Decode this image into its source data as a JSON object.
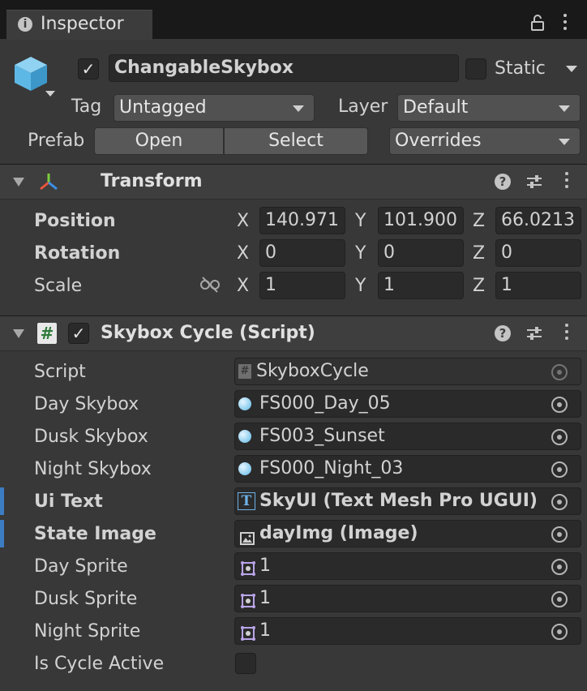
{
  "tab": {
    "title": "Inspector"
  },
  "gameobject": {
    "active": true,
    "name": "ChangableSkybox",
    "static_label": "Static",
    "static_checked": false,
    "tag_label": "Tag",
    "tag_value": "Untagged",
    "layer_label": "Layer",
    "layer_value": "Default",
    "prefab_label": "Prefab",
    "prefab_open": "Open",
    "prefab_select": "Select",
    "prefab_overrides": "Overrides"
  },
  "transform": {
    "title": "Transform",
    "position": {
      "label": "Position",
      "x": "140.971",
      "y": "101.900",
      "z": "66.0213"
    },
    "rotation": {
      "label": "Rotation",
      "x": "0",
      "y": "0",
      "z": "0"
    },
    "scale": {
      "label": "Scale",
      "x": "1",
      "y": "1",
      "z": "1"
    },
    "axis": {
      "x": "X",
      "y": "Y",
      "z": "Z"
    }
  },
  "component": {
    "title": "Skybox Cycle (Script)",
    "enabled": true,
    "fields": [
      {
        "label": "Script",
        "value": "SkyboxCycle"
      },
      {
        "label": "Day Skybox",
        "value": "FS000_Day_05"
      },
      {
        "label": "Dusk Skybox",
        "value": "FS003_Sunset"
      },
      {
        "label": "Night Skybox",
        "value": "FS000_Night_03"
      },
      {
        "label": "Ui Text",
        "value": "SkyUI (Text Mesh Pro UGUI)"
      },
      {
        "label": "State Image",
        "value": "dayImg (Image)"
      },
      {
        "label": "Day Sprite",
        "value": "1"
      },
      {
        "label": "Dusk Sprite",
        "value": "1"
      },
      {
        "label": "Night Sprite",
        "value": "1"
      },
      {
        "label": "Is Cycle Active",
        "value": ""
      }
    ]
  },
  "icons": {
    "tab": "info-icon",
    "lock": "lock-icon",
    "menu": "kebab-menu-icon",
    "gameobject": "cube-icon",
    "transform": "transform-axes-icon",
    "script": "script-hash-icon",
    "help": "help-icon",
    "presets": "presets-sliders-icon",
    "link": "constrain-proportions-icon",
    "material": "material-sphere-icon",
    "text": "text-mesh-icon",
    "image": "image-icon",
    "sprite": "sprite-icon",
    "object_picker": "object-picker-icon"
  },
  "colors": {
    "background": "#383838",
    "tabbar": "#191919",
    "field": "#2a2a2a",
    "accent_blue": "#3c7cc2",
    "cube": "#5eb8e6"
  }
}
